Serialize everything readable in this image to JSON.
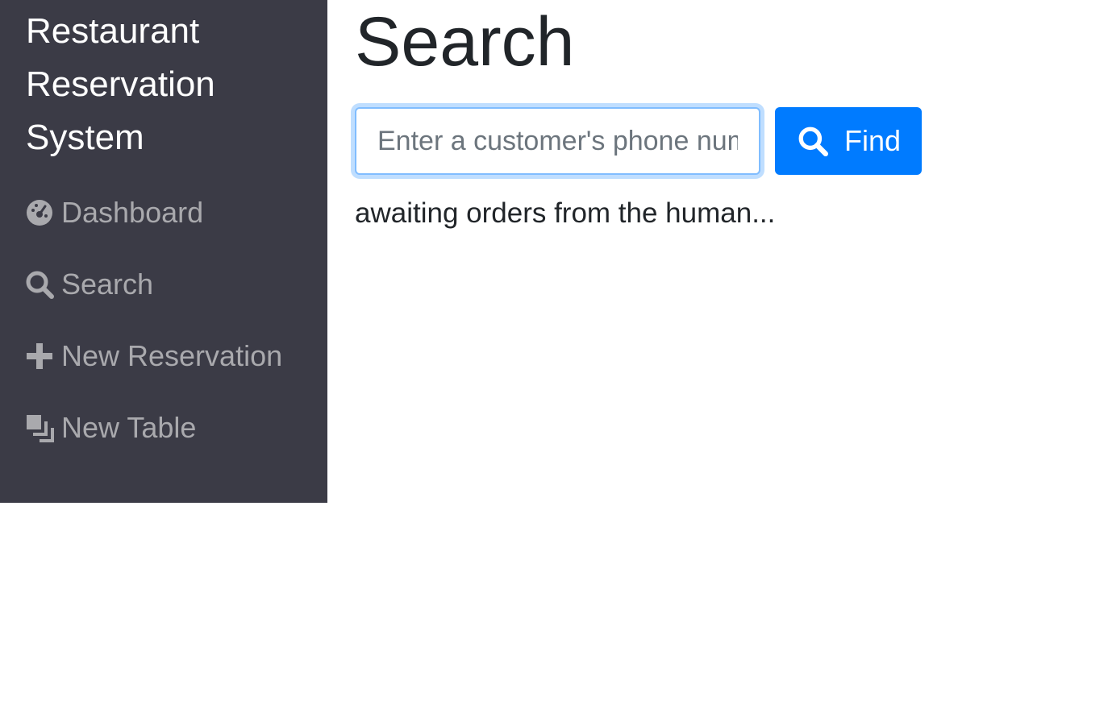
{
  "sidebar": {
    "brand": "Restaurant Reservation System",
    "items": [
      {
        "label": "Dashboard",
        "icon": "dashboard-icon"
      },
      {
        "label": "Search",
        "icon": "search-icon"
      },
      {
        "label": "New Reservation",
        "icon": "plus-icon"
      },
      {
        "label": "New Table",
        "icon": "layers-icon"
      }
    ]
  },
  "main": {
    "title": "Search",
    "search": {
      "placeholder": "Enter a customer's phone number",
      "value": ""
    },
    "find_label": "Find",
    "status": "awaiting orders from the human..."
  },
  "colors": {
    "sidebar_bg": "#3b3b46",
    "nav_text": "#a9a9ad",
    "accent": "#007bff"
  }
}
